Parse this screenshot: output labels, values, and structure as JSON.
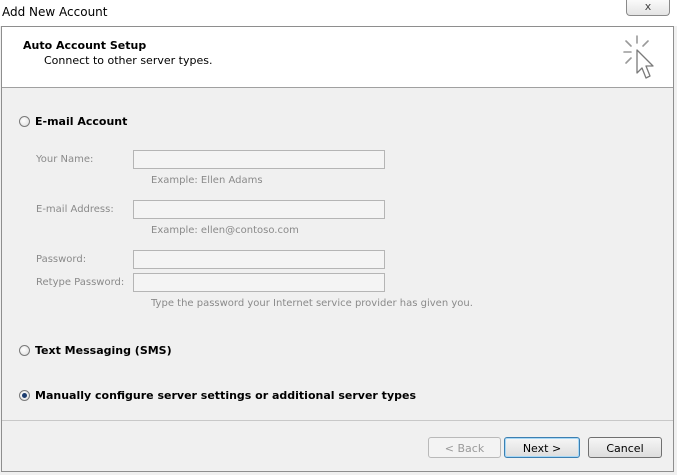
{
  "window": {
    "title": "Add New Account",
    "close_glyph": "x"
  },
  "header": {
    "title": "Auto Account Setup",
    "subtitle": "Connect to other server types.",
    "icon": "cursor-click-icon"
  },
  "options": {
    "email_account": {
      "label": "E-mail Account",
      "selected": false
    },
    "sms": {
      "label": "Text Messaging (SMS)",
      "selected": false
    },
    "manual": {
      "label": "Manually configure server settings or additional server types",
      "selected": true
    }
  },
  "fields": {
    "your_name": {
      "label": "Your Name:",
      "value": "",
      "hint": "Example: Ellen Adams"
    },
    "email_address": {
      "label": "E-mail Address:",
      "value": "",
      "hint": "Example: ellen@contoso.com"
    },
    "password": {
      "label": "Password:",
      "value": ""
    },
    "retype_password": {
      "label": "Retype Password:",
      "value": "",
      "hint": "Type the password your Internet service provider has given you."
    }
  },
  "buttons": {
    "back": "< Back",
    "next": "Next >",
    "cancel": "Cancel"
  }
}
